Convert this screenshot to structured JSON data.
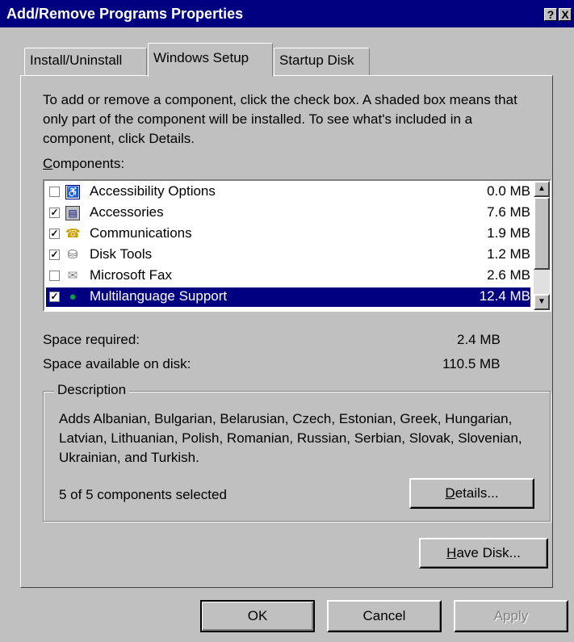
{
  "window": {
    "title": "Add/Remove Programs Properties",
    "help_btn": "?",
    "close_btn": "X"
  },
  "tabs": [
    {
      "label": "Install/Uninstall",
      "active": false
    },
    {
      "label": "Windows Setup",
      "active": true
    },
    {
      "label": "Startup Disk",
      "active": false
    }
  ],
  "intro_text": "To add or remove a component, click the check box. A shaded box means that only part of the component will be installed. To see what's included in a component, click Details.",
  "components_label": {
    "mnemonic": "C",
    "rest": "omponents:"
  },
  "components": [
    {
      "name": "Accessibility Options",
      "size": "0.0 MB",
      "checked": false,
      "selected": false,
      "icon": "accessibility-icon"
    },
    {
      "name": "Accessories",
      "size": "7.6 MB",
      "checked": true,
      "selected": false,
      "icon": "accessories-icon"
    },
    {
      "name": "Communications",
      "size": "1.9 MB",
      "checked": true,
      "selected": false,
      "icon": "communications-icon"
    },
    {
      "name": "Disk Tools",
      "size": "1.2 MB",
      "checked": true,
      "selected": false,
      "icon": "disk-tools-icon"
    },
    {
      "name": "Microsoft Fax",
      "size": "2.6 MB",
      "checked": false,
      "selected": false,
      "icon": "fax-icon"
    },
    {
      "name": "Multilanguage Support",
      "size": "12.4 MB",
      "checked": true,
      "selected": true,
      "icon": "globe-icon"
    }
  ],
  "space_required_label": "Space required:",
  "space_required_value": "2.4 MB",
  "space_available_label": "Space available on disk:",
  "space_available_value": "110.5 MB",
  "description_title": "Description",
  "description_text": "Adds Albanian, Bulgarian, Belarusian, Czech, Estonian, Greek, Hungarian, Latvian, Lithuanian, Polish, Romanian, Russian, Serbian, Slovak, Slovenian, Ukrainian, and Turkish.",
  "selected_count": "5 of 5 components selected",
  "details_button": {
    "mnemonic": "D",
    "rest": "etails..."
  },
  "have_disk_button": {
    "mnemonic": "H",
    "rest": "ave Disk..."
  },
  "ok_button": "OK",
  "cancel_button": "Cancel",
  "apply_button": "Apply",
  "colors": {
    "title_bar": "#000080",
    "face": "#c0c0c0",
    "selection": "#000080"
  }
}
